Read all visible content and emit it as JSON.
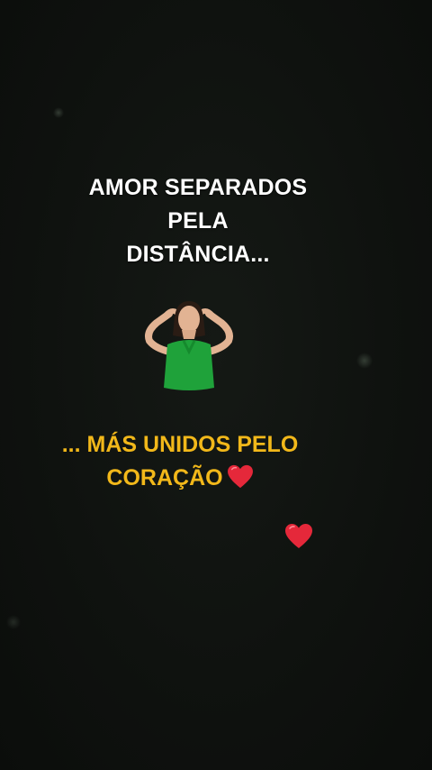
{
  "headline": {
    "line1": "AMOR SEPARADOS",
    "line2": "PELA",
    "line3": "DISTÂNCIA..."
  },
  "subline": {
    "line1": "... MÁS UNIDOS PELO",
    "line2": "CORAÇÃO"
  },
  "colors": {
    "headline": "#ffffff",
    "subline": "#f2b81a",
    "heart": "#e5283a",
    "shirt": "#1fa23a"
  },
  "icons": [
    "red-heart-icon",
    "woman-heart-hands-sticker"
  ]
}
